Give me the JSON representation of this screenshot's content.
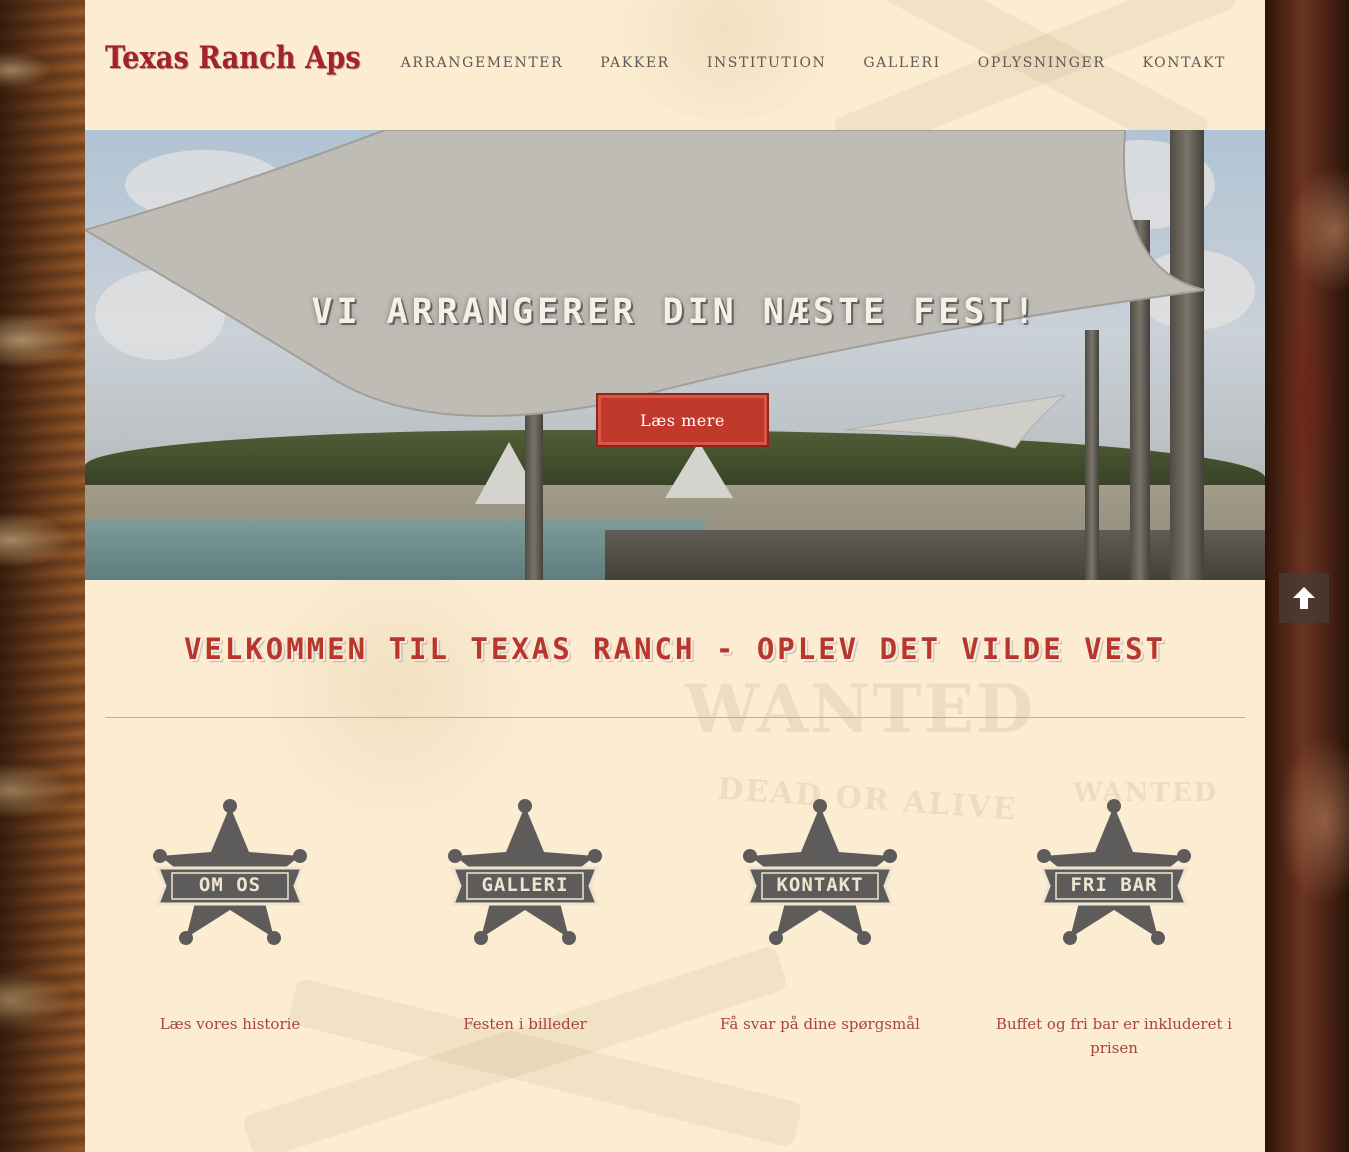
{
  "header": {
    "logo": "Texas Ranch Aps",
    "nav": [
      "ARRANGEMENTER",
      "PAKKER",
      "INSTITUTION",
      "GALLERI",
      "OPLYSNINGER",
      "KONTAKT"
    ]
  },
  "hero": {
    "title": "VI ARRANGERER DIN NÆSTE FEST!",
    "button": "Læs mere"
  },
  "welcome": {
    "title": "VELKOMMEN TIL TEXAS RANCH - OPLEV DET VILDE VEST"
  },
  "badges": [
    {
      "label": "OM OS",
      "caption": "Læs vores historie"
    },
    {
      "label": "GALLERI",
      "caption": "Festen i billeder"
    },
    {
      "label": "KONTAKT",
      "caption": "Få svar på dine spørgsmål"
    },
    {
      "label": "FRI BAR",
      "caption": "Buffet og fri bar er inkluderet i prisen"
    }
  ],
  "decor": {
    "wanted": "WANTED",
    "dead_or_alive": "DEAD OR ALIVE",
    "wanted_small": "WANTED"
  },
  "colors": {
    "accent": "#c0392b",
    "logo": "#a4222a",
    "parchment": "#fbecd2",
    "badge": "#5e5c5b"
  },
  "icons": {
    "scroll_top": "arrow-up-icon"
  }
}
